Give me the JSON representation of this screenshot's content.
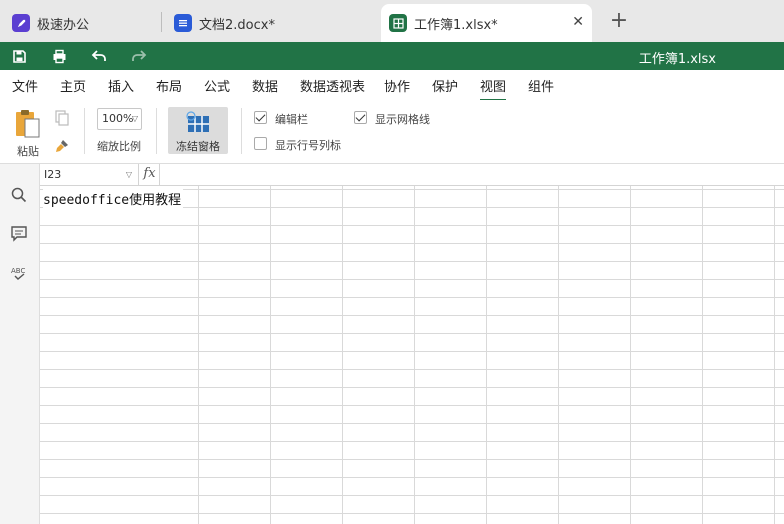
{
  "tabs": [
    {
      "label": "极速办公",
      "icon": "rocket-icon",
      "color": "#5b3fd1"
    },
    {
      "label": "文档2.docx*",
      "icon": "doc-icon",
      "color": "#2a5bd7"
    },
    {
      "label": "工作簿1.xlsx*",
      "icon": "sheet-icon",
      "color": "#217346"
    }
  ],
  "tab_close": "✕",
  "new_tab": "+",
  "quickbar": {
    "title": "工作簿1.xlsx",
    "color": "#217346"
  },
  "menu": [
    "文件",
    "主页",
    "插入",
    "布局",
    "公式",
    "数据",
    "数据透视表",
    "协作",
    "保护",
    "视图",
    "组件"
  ],
  "active_menu": "视图",
  "ribbon": {
    "paste_label": "粘贴",
    "zoom_value": "100%",
    "zoom_label": "缩放比例",
    "freeze_label": "冻结窗格",
    "formula_bar_label": "编辑栏",
    "formula_bar_checked": true,
    "gridlines_label": "显示网格线",
    "gridlines_checked": true,
    "headings_label": "显示行号列标",
    "headings_checked": false
  },
  "formula_bar": {
    "name_box": "I23",
    "fx": "fx",
    "value": ""
  },
  "sheet": {
    "a1_text": "speedoffice使用教程"
  }
}
